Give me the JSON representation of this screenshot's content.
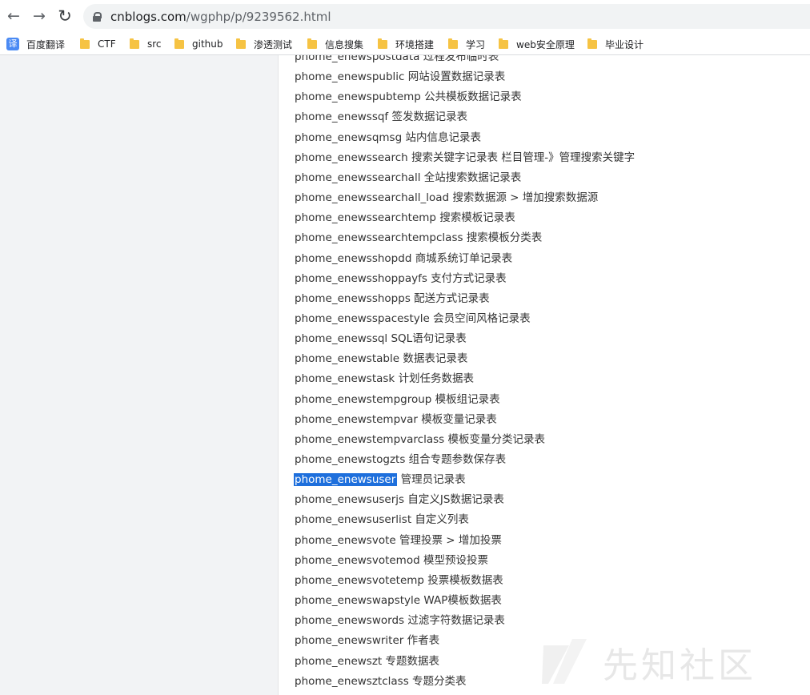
{
  "browser": {
    "url_host": "cnblogs.com",
    "url_path": "/wgphp/p/9239562.html",
    "back_glyph": "←",
    "forward_glyph": "→",
    "reload_glyph": "↻"
  },
  "bookmarks": [
    {
      "label": "百度翻译",
      "icon": "translate-icon",
      "glyph": "译"
    },
    {
      "label": "CTF",
      "icon": "folder-icon"
    },
    {
      "label": "src",
      "icon": "folder-icon"
    },
    {
      "label": "github",
      "icon": "folder-icon"
    },
    {
      "label": "渗透测试",
      "icon": "folder-icon"
    },
    {
      "label": "信息搜集",
      "icon": "folder-icon"
    },
    {
      "label": "环境搭建",
      "icon": "folder-icon"
    },
    {
      "label": "学习",
      "icon": "folder-icon"
    },
    {
      "label": "web安全原理",
      "icon": "folder-icon"
    },
    {
      "label": "毕业设计",
      "icon": "folder-icon"
    }
  ],
  "rows": [
    {
      "code": "phome_enewspostdata",
      "desc": "过程发布临时表"
    },
    {
      "code": "phome_enewspublic",
      "desc": "网站设置数据记录表"
    },
    {
      "code": "phome_enewspubtemp",
      "desc": "公共模板数据记录表"
    },
    {
      "code": "phome_enewssqf",
      "desc": "签发数据记录表"
    },
    {
      "code": "phome_enewsqmsg",
      "desc": "站内信息记录表"
    },
    {
      "code": "phome_enewssearch",
      "desc": "搜索关键字记录表 栏目管理-》管理搜索关键字"
    },
    {
      "code": "phome_enewssearchall",
      "desc": "全站搜索数据记录表"
    },
    {
      "code": "phome_enewssearchall_load",
      "desc": "搜索数据源 > 增加搜索数据源"
    },
    {
      "code": "phome_enewssearchtemp",
      "desc": "搜索模板记录表"
    },
    {
      "code": "phome_enewssearchtempclass",
      "desc": "搜索模板分类表"
    },
    {
      "code": "phome_enewsshopdd",
      "desc": "商城系统订单记录表"
    },
    {
      "code": "phome_enewsshoppayfs",
      "desc": "支付方式记录表"
    },
    {
      "code": "phome_enewsshopps",
      "desc": "配送方式记录表"
    },
    {
      "code": "phome_enewsspacestyle",
      "desc": "会员空间风格记录表"
    },
    {
      "code": "phome_enewssql",
      "desc": "SQL语句记录表"
    },
    {
      "code": "phome_enewstable",
      "desc": "数据表记录表"
    },
    {
      "code": "phome_enewstask",
      "desc": "计划任务数据表"
    },
    {
      "code": "phome_enewstempgroup",
      "desc": "模板组记录表"
    },
    {
      "code": "phome_enewstempvar",
      "desc": "模板变量记录表"
    },
    {
      "code": "phome_enewstempvarclass",
      "desc": "模板变量分类记录表"
    },
    {
      "code": "phome_enewstogzts",
      "desc": "组合专题参数保存表"
    },
    {
      "code": "phome_enewsuser",
      "desc": "管理员记录表",
      "selected": true
    },
    {
      "code": "phome_enewsuserjs",
      "desc": "自定义JS数据记录表"
    },
    {
      "code": "phome_enewsuserlist",
      "desc": "自定义列表"
    },
    {
      "code": "phome_enewsvote",
      "desc": "管理投票 > 增加投票"
    },
    {
      "code": "phome_enewsvotemod",
      "desc": "模型预设投票"
    },
    {
      "code": "phome_enewsvotetemp",
      "desc": "投票模板数据表"
    },
    {
      "code": "phome_enewswapstyle",
      "desc": "WAP模板数据表"
    },
    {
      "code": " phome_enewswords",
      "desc": "过滤字符数据记录表"
    },
    {
      "code": "phome_enewswriter",
      "desc": "作者表"
    },
    {
      "code": "phome_enewszt",
      "desc": "专题数据表"
    },
    {
      "code": "phome_enewsztclass",
      "desc": "专题分类表"
    }
  ],
  "watermark": {
    "text": "先知社区"
  }
}
